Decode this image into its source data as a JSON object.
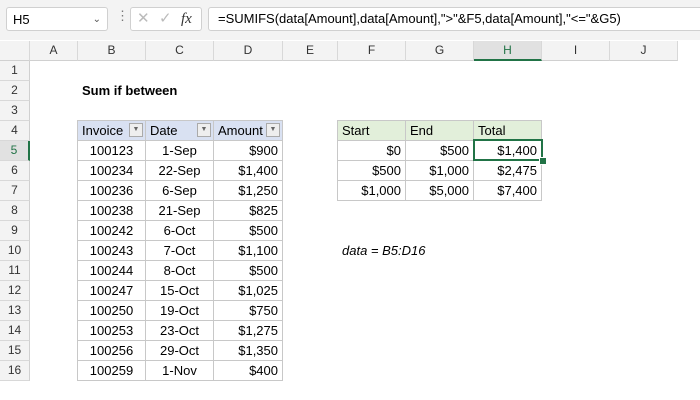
{
  "name_box": "H5",
  "formula": "=SUMIFS(data[Amount],data[Amount],\">\"&F5,data[Amount],\"<=\"&G5)",
  "columns": [
    "A",
    "B",
    "C",
    "D",
    "E",
    "F",
    "G",
    "H",
    "I",
    "J"
  ],
  "rows": [
    "1",
    "2",
    "3",
    "4",
    "5",
    "6",
    "7",
    "8",
    "9",
    "10",
    "11",
    "12",
    "13",
    "14",
    "15",
    "16"
  ],
  "title": "Sum if between",
  "data_table": {
    "headers": [
      "Invoice",
      "Date",
      "Amount"
    ],
    "rows": [
      [
        "100123",
        "1-Sep",
        "$900"
      ],
      [
        "100234",
        "22-Sep",
        "$1,400"
      ],
      [
        "100236",
        "6-Sep",
        "$1,250"
      ],
      [
        "100238",
        "21-Sep",
        "$825"
      ],
      [
        "100242",
        "6-Oct",
        "$500"
      ],
      [
        "100243",
        "7-Oct",
        "$1,100"
      ],
      [
        "100244",
        "8-Oct",
        "$500"
      ],
      [
        "100247",
        "15-Oct",
        "$1,025"
      ],
      [
        "100250",
        "19-Oct",
        "$750"
      ],
      [
        "100253",
        "23-Oct",
        "$1,275"
      ],
      [
        "100256",
        "29-Oct",
        "$1,350"
      ],
      [
        "100259",
        "1-Nov",
        "$400"
      ]
    ]
  },
  "summary_table": {
    "headers": [
      "Start",
      "End",
      "Total"
    ],
    "rows": [
      [
        "$0",
        "$500",
        "$1,400"
      ],
      [
        "$500",
        "$1,000",
        "$2,475"
      ],
      [
        "$1,000",
        "$5,000",
        "$7,400"
      ]
    ]
  },
  "note": "data = B5:D16",
  "colors": {
    "accent": "#217346",
    "table_header": "#d9e1f2",
    "summary_header": "#e2efda"
  }
}
